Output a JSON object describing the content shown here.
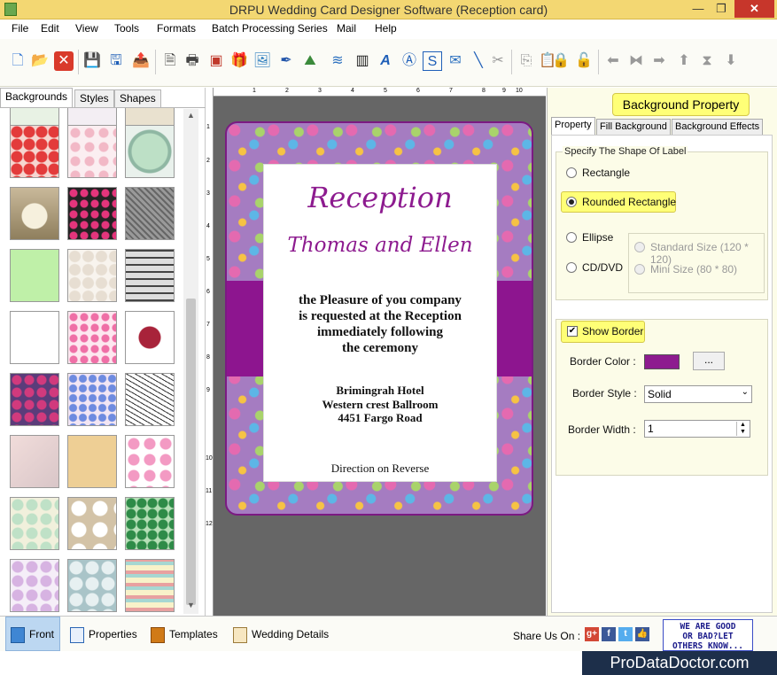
{
  "window": {
    "title": "DRPU Wedding Card Designer Software (Reception card)",
    "min": "—",
    "max": "❐",
    "close": "✕"
  },
  "menu": [
    "File",
    "Edit",
    "View",
    "Tools",
    "Formats",
    "Batch Processing Series",
    "Mail",
    "Help"
  ],
  "left_tabs": [
    "Backgrounds",
    "Styles",
    "Shapes"
  ],
  "ruler": {
    "h_ticks": [
      "1",
      "2",
      "3",
      "4",
      "5",
      "6",
      "7",
      "8",
      "9",
      "10"
    ],
    "v_ticks": [
      "1",
      "2",
      "3",
      "4",
      "5",
      "6",
      "7",
      "8",
      "9",
      "10",
      "11",
      "12"
    ]
  },
  "card": {
    "title": "Reception",
    "names": "Thomas and Ellen",
    "message_lines": [
      "the Pleasure of you company",
      "is requested at the Reception",
      "immediately following",
      "the ceremony"
    ],
    "venue_lines": [
      "Brimingrah Hotel",
      "Western crest Ballroom",
      "4451 Fargo Road"
    ],
    "footer": "Direction on Reverse"
  },
  "right_panel": {
    "heading": "Background Property",
    "tabs": [
      "Property",
      "Fill Background",
      "Background Effects"
    ],
    "shape_group_label": "Specify The Shape Of Label",
    "shapes": {
      "rectangle": "Rectangle",
      "rounded": "Rounded Rectangle",
      "ellipse": "Ellipse",
      "cd": "CD/DVD"
    },
    "sizes": {
      "standard": "Standard Size (120 * 120)",
      "mini": "Mini Size (80 * 80)"
    },
    "show_border": "Show Border",
    "border_color_label": "Border Color :",
    "border_color": "#8d1b8f",
    "browse_label": "...",
    "border_style_label": "Border Style :",
    "border_style_value": "Solid",
    "border_width_label": "Border Width :",
    "border_width_value": "1"
  },
  "bottom": {
    "front": "Front",
    "properties": "Properties",
    "templates": "Templates",
    "wedding_details": "Wedding Details",
    "share_on": "Share Us On :",
    "feedback_lines": [
      "WE ARE GOOD",
      "OR BAD?LET",
      "OTHERS KNOW..."
    ]
  },
  "brand": "ProDataDoctor.com",
  "colors": {
    "title_bar": "#f3d772",
    "accent_purple": "#8d1b8f",
    "highlight_yellow": "#ffff77"
  }
}
